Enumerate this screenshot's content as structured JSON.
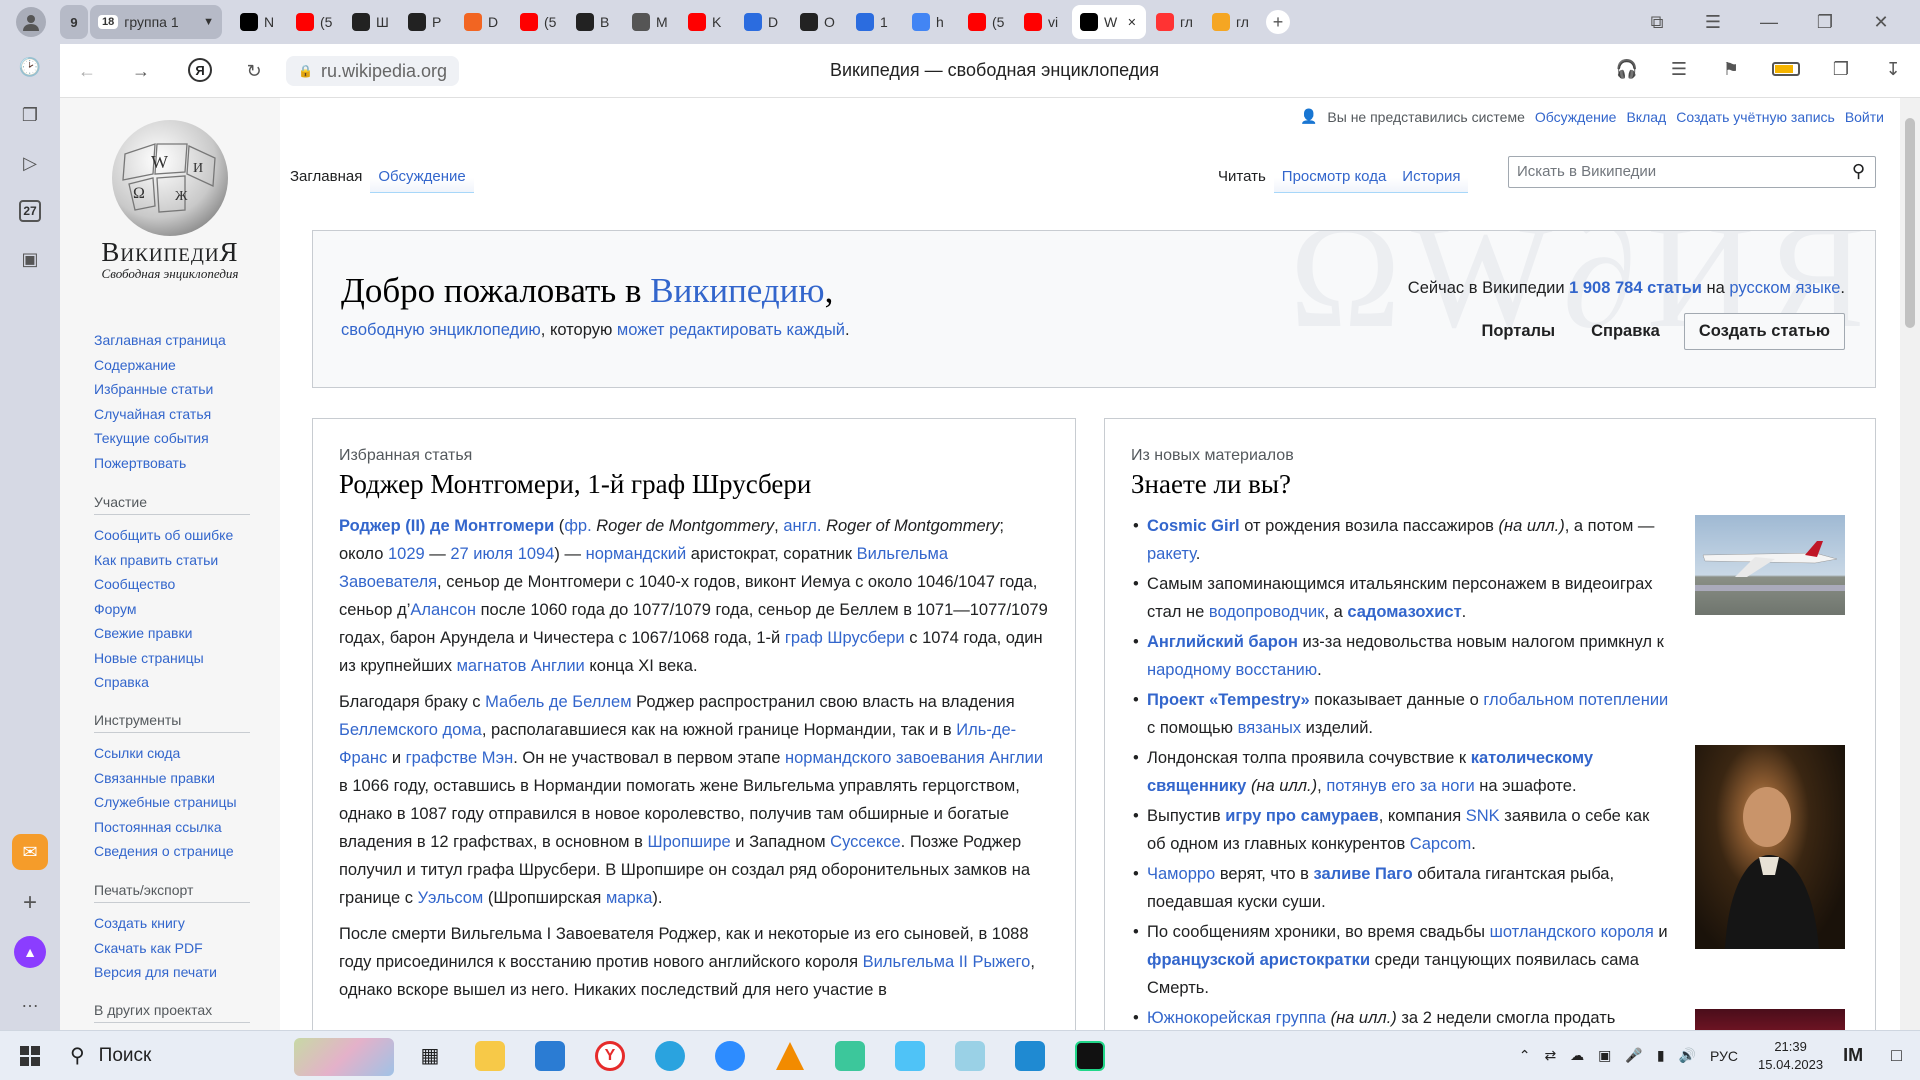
{
  "browser": {
    "group_count": "9",
    "group_label": "группа 1",
    "group_badge": "18",
    "tabs": [
      {
        "label": "N",
        "color": "#000000",
        "icon": "notion-icon"
      },
      {
        "label": "(5",
        "color": "#ff0000",
        "icon": "youtube-icon"
      },
      {
        "label": "Ш",
        "color": "#222222",
        "icon": "skillbox-icon"
      },
      {
        "label": "Р",
        "color": "#222222",
        "icon": "github-icon"
      },
      {
        "label": "D",
        "color": "#f26522",
        "icon": "brave-icon"
      },
      {
        "label": "(5",
        "color": "#ff0000",
        "icon": "youtube-icon"
      },
      {
        "label": "В",
        "color": "#222222",
        "icon": "openai-icon"
      },
      {
        "label": "М",
        "color": "#555555",
        "icon": "page-icon"
      },
      {
        "label": "K",
        "color": "#ff0000",
        "icon": "youtube-icon"
      },
      {
        "label": "D",
        "color": "#2b6cdf",
        "icon": "deepl-icon"
      },
      {
        "label": "О",
        "color": "#222222",
        "icon": "openai-icon"
      },
      {
        "label": "1",
        "color": "#2b6cdf",
        "icon": "deepl-icon"
      },
      {
        "label": "h",
        "color": "#4285f4",
        "icon": "docs-icon"
      },
      {
        "label": "(5",
        "color": "#ff0000",
        "icon": "youtube-icon"
      },
      {
        "label": "vi",
        "color": "#ff0000",
        "icon": "youtube-icon"
      },
      {
        "label": "W",
        "color": "#000000",
        "icon": "wikipedia-icon",
        "active": true
      },
      {
        "label": "гл",
        "color": "#ff3333",
        "icon": "yandex-icon"
      },
      {
        "label": "гл",
        "color": "#f5a623",
        "icon": "yandex-images-icon"
      }
    ],
    "address": "ru.wikipedia.org",
    "page_title": "Википедия — свободная энциклопедия",
    "sidebar_date": "27"
  },
  "wiki": {
    "logo_title": "ВикипедиЯ",
    "logo_subtitle": "Свободная энциклопедия",
    "personal": [
      "Вы не представились системе",
      "Обсуждение",
      "Вклад",
      "Создать учётную запись",
      "Войти"
    ],
    "ns_tabs": [
      "Заглавная",
      "Обсуждение"
    ],
    "view_tabs": [
      "Читать",
      "Просмотр кода",
      "История"
    ],
    "search_placeholder": "Искать в Википедии",
    "nav_main": [
      "Заглавная страница",
      "Содержание",
      "Избранные статьи",
      "Случайная статья",
      "Текущие события",
      "Пожертвовать"
    ],
    "nav_participate_head": "Участие",
    "nav_participate": [
      "Сообщить об ошибке",
      "Как править статьи",
      "Сообщество",
      "Форум",
      "Свежие правки",
      "Новые страницы",
      "Справка"
    ],
    "nav_tools_head": "Инструменты",
    "nav_tools": [
      "Ссылки сюда",
      "Связанные правки",
      "Служебные страницы",
      "Постоянная ссылка",
      "Сведения о странице"
    ],
    "nav_print_head": "Печать/экспорт",
    "nav_print": [
      "Создать книгу",
      "Скачать как PDF",
      "Версия для печати"
    ],
    "nav_other_head": "В других проектах",
    "welcome": {
      "title_a": "Добро пожаловать в ",
      "title_link": "Википедию",
      "title_b": ",",
      "sub_link1": "свободную энциклопедию",
      "sub_mid": ", которую ",
      "sub_link2": "может редактировать каждый",
      "sub_end": ".",
      "stats_a": "Сейчас в Википедии ",
      "stats_count": "1 908 784 статьи",
      "stats_b": " на ",
      "stats_lang": "русском языке",
      "stats_end": ".",
      "portals": "Порталы",
      "help": "Справка",
      "create": "Создать статью"
    },
    "featured": {
      "label": "Избранная статья",
      "title": "Роджер Монтгомери, 1-й граф Шрусбери",
      "p1": [
        [
          "l",
          "Роджер (II) де Монтгомери",
          1
        ],
        [
          "t",
          " ("
        ],
        [
          "l",
          "фр."
        ],
        [
          "t",
          " "
        ],
        [
          "i",
          "Roger de Montgommery"
        ],
        [
          "t",
          ", "
        ],
        [
          "l",
          "англ."
        ],
        [
          "t",
          " "
        ],
        [
          "i",
          "Roger of Montgommery"
        ],
        [
          "t",
          "; около "
        ],
        [
          "l",
          "1029"
        ],
        [
          "t",
          " — "
        ],
        [
          "l",
          "27 июля"
        ],
        [
          "t",
          " "
        ],
        [
          "l",
          "1094"
        ],
        [
          "t",
          ") — "
        ],
        [
          "l",
          "нормандский"
        ],
        [
          "t",
          " аристократ, соратник "
        ],
        [
          "l",
          "Вильгельма Завоевателя"
        ],
        [
          "t",
          ", сеньор де Монтгомери с 1040-х годов, виконт Иемуа с около 1046/1047 года, сеньор д’"
        ],
        [
          "l",
          "Алансон"
        ],
        [
          "t",
          " после 1060 года до 1077/1079 года, сеньор де Беллем в 1071—1077/1079 годах, барон Арундела и Чичестера с 1067/1068 года, 1-й "
        ],
        [
          "l",
          "граф Шрусбери"
        ],
        [
          "t",
          " с 1074 года, один из крупнейших "
        ],
        [
          "l",
          "магнатов Англии"
        ],
        [
          "t",
          " конца XI века."
        ]
      ],
      "p2": [
        [
          "t",
          "Благодаря браку с "
        ],
        [
          "l",
          "Мабель де Беллем"
        ],
        [
          "t",
          " Роджер распространил свою власть на владения "
        ],
        [
          "l",
          "Беллемского дома"
        ],
        [
          "t",
          ", располагавшиеся как на южной границе Нормандии, так и в "
        ],
        [
          "l",
          "Иль-де-Франс"
        ],
        [
          "t",
          " и "
        ],
        [
          "l",
          "графстве Мэн"
        ],
        [
          "t",
          ". Он не участвовал в первом этапе "
        ],
        [
          "l",
          "нормандского завоевания Англии"
        ],
        [
          "t",
          " в 1066 году, оставшись в Нормандии помогать жене Вильгельма управлять герцогством, однако в 1087 году отправился в новое королевство, получив там обширные и богатые владения в 12 графствах, в основном в "
        ],
        [
          "l",
          "Шропшире"
        ],
        [
          "t",
          " и Западном "
        ],
        [
          "l",
          "Суссексе"
        ],
        [
          "t",
          ". Позже Роджер получил и титул графа Шрусбери. В Шропшире он создал ряд оборонительных замков на границе с "
        ],
        [
          "l",
          "Уэльсом"
        ],
        [
          "t",
          " (Шропширская "
        ],
        [
          "l",
          "марка"
        ],
        [
          "t",
          ")."
        ]
      ],
      "p3": [
        [
          "t",
          "После смерти Вильгельма I Завоевателя Роджер, как и некоторые из его сыновей, в 1088 году присоединился к восстанию против нового английского короля "
        ],
        [
          "l",
          "Вильгельма II Рыжего"
        ],
        [
          "t",
          ", однако вскоре вышел из него. Никаких последствий для него участие в"
        ]
      ]
    },
    "dyk": {
      "label": "Из новых материалов",
      "title": "Знаете ли вы?",
      "items": [
        [
          [
            "l",
            "Cosmic Girl",
            1
          ],
          [
            "t",
            " от рождения возила пассажиров "
          ],
          [
            "i",
            "(на илл.)"
          ],
          [
            "t",
            ", а потом — "
          ],
          [
            "l",
            "ракету"
          ],
          [
            "t",
            "."
          ]
        ],
        [
          [
            "t",
            "Самым запоминающимся итальянским персонажем в видеоиграх стал не "
          ],
          [
            "l",
            "водопроводчик"
          ],
          [
            "t",
            ", а "
          ],
          [
            "l",
            "садомазохист",
            1
          ],
          [
            "t",
            "."
          ]
        ],
        [
          [
            "l",
            "Английский барон",
            1
          ],
          [
            "t",
            " из-за недовольства новым налогом примкнул к "
          ],
          [
            "l",
            "народному восстанию"
          ],
          [
            "t",
            "."
          ]
        ],
        [
          [
            "l",
            "Проект «Tempestry»",
            1
          ],
          [
            "t",
            " показывает данные о "
          ],
          [
            "l",
            "глобальном потеплении"
          ],
          [
            "t",
            " с помощью "
          ],
          [
            "l",
            "вязаных"
          ],
          [
            "t",
            " изделий."
          ]
        ],
        [
          [
            "t",
            "Лондонская толпа проявила сочувствие к "
          ],
          [
            "l",
            "католическому священнику",
            1
          ],
          [
            "t",
            " "
          ],
          [
            "i",
            "(на илл.)"
          ],
          [
            "t",
            ", "
          ],
          [
            "l",
            "потянув его за ноги"
          ],
          [
            "t",
            " на эшафоте."
          ]
        ],
        [
          [
            "t",
            "Выпустив "
          ],
          [
            "l",
            "игру про самураев",
            1
          ],
          [
            "t",
            ", компания "
          ],
          [
            "l",
            "SNK"
          ],
          [
            "t",
            " заявила о себе как об одном из главных конкурентов "
          ],
          [
            "l",
            "Capcom"
          ],
          [
            "t",
            "."
          ]
        ],
        [
          [
            "l",
            "Чаморро"
          ],
          [
            "t",
            " верят, что в "
          ],
          [
            "l",
            "заливе Паго",
            1
          ],
          [
            "t",
            " обитала гигантская рыба, поедавшая куски суши."
          ]
        ],
        [
          [
            "t",
            "По сообщениям хроники, во время свадьбы "
          ],
          [
            "l",
            "шотландского короля"
          ],
          [
            "t",
            " и "
          ],
          [
            "l",
            "французской аристократки",
            1
          ],
          [
            "t",
            " среди танцующих появилась сама Смерть."
          ]
        ],
        [
          [
            "l",
            "Южнокорейская группа"
          ],
          [
            "t",
            " "
          ],
          [
            "i",
            "(на илл.)"
          ],
          [
            "t",
            " за 2 недели смогла продать"
          ]
        ]
      ]
    }
  },
  "taskbar": {
    "search": "Поиск",
    "lang": "РУС",
    "time": "21:39",
    "date": "15.04.2023"
  },
  "colors": {
    "link": "#3366cc",
    "visited_dark": "#0645ad",
    "chrome": "#d6d9e4"
  }
}
